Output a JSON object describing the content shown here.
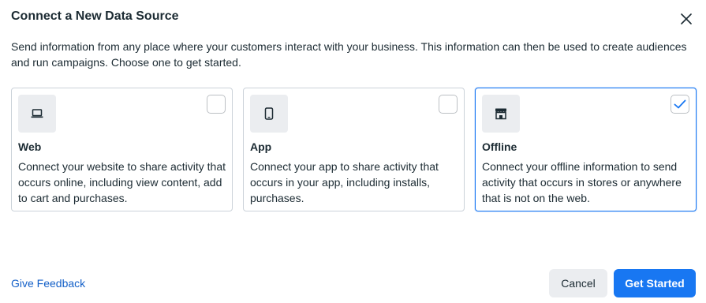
{
  "dialog": {
    "title": "Connect a New Data Source",
    "close_icon": "close-icon",
    "description": "Send information from any place where your customers interact with your business. This information can then be used to create audiences and run campaigns. Choose one to get started."
  },
  "cards": [
    {
      "title": "Web",
      "description": "Connect your website to share activity that occurs online, including view content, add to cart and purchases.",
      "icon": "laptop-icon",
      "selected": false
    },
    {
      "title": "App",
      "description": "Connect your app to share activity that occurs in your app, including installs, purchases.",
      "icon": "phone-icon",
      "selected": false
    },
    {
      "title": "Offline",
      "description": "Connect your offline information to send activity that occurs in stores or anywhere that is not on the web.",
      "icon": "store-icon",
      "selected": true
    }
  ],
  "footer": {
    "feedback_label": "Give Feedback",
    "cancel_label": "Cancel",
    "primary_label": "Get Started"
  },
  "colors": {
    "accent": "#1877f2",
    "link": "#1460c8",
    "text": "#1c2b33",
    "icon_bg": "#ebedf0"
  }
}
